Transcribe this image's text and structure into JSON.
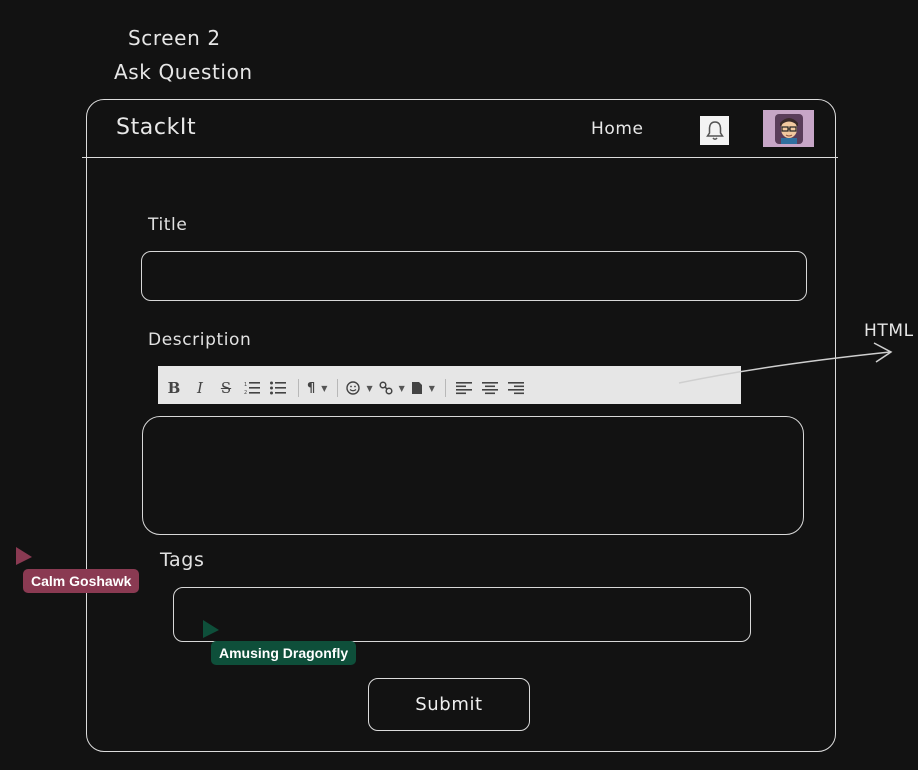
{
  "canvas": {
    "screen_label": "Screen 2",
    "heading": "Ask Question",
    "annotation": "HTML"
  },
  "navbar": {
    "brand": "StackIt",
    "home": "Home"
  },
  "form": {
    "title_label": "Title",
    "title_value": "",
    "description_label": "Description",
    "description_value": "",
    "tags_label": "Tags",
    "tags_value": "",
    "submit_label": "Submit"
  },
  "toolbar": {
    "bold": "B",
    "italic": "I",
    "strike": "S",
    "paragraph": "¶"
  },
  "cursors": [
    {
      "name": "Calm Goshawk",
      "color": "#8a3a52"
    },
    {
      "name": "Amusing Dragonfly",
      "color": "#0e4f3a"
    }
  ]
}
